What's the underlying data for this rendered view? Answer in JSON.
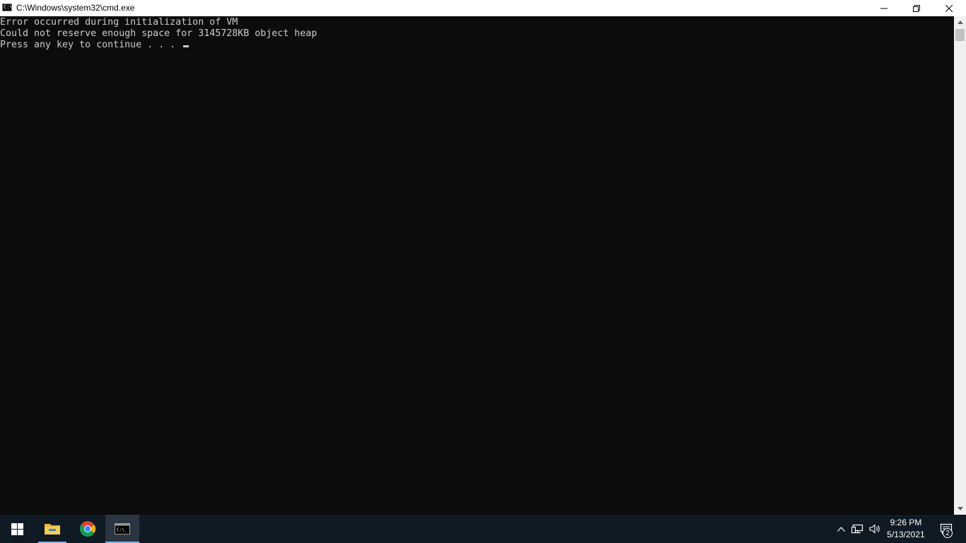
{
  "window": {
    "title": "C:\\Windows\\system32\\cmd.exe",
    "icon_text": "C:\\",
    "icon": "cmd-icon",
    "buttons": {
      "minimize": "minimize-icon",
      "restore": "restore-icon",
      "close": "close-icon"
    }
  },
  "console": {
    "lines": [
      "Error occurred during initialization of VM",
      "Could not reserve enough space for 3145728KB object heap",
      "Press any key to continue . . . "
    ],
    "text_color": "#cccccc",
    "background": "#0c0c0c"
  },
  "taskbar": {
    "apps": [
      {
        "name": "start",
        "icon": "windows-logo-icon"
      },
      {
        "name": "file-explorer",
        "icon": "folder-icon"
      },
      {
        "name": "chrome",
        "icon": "chrome-icon"
      },
      {
        "name": "command-prompt",
        "icon": "cmd-icon",
        "active": true
      }
    ],
    "tray": {
      "chevron": "chevron-up-icon",
      "network": "network-icon",
      "volume": "volume-icon",
      "time": "9:26 PM",
      "date": "5/13/2021",
      "notification_count": "2"
    },
    "accent": "#76b9ed",
    "background": "#101a25"
  }
}
